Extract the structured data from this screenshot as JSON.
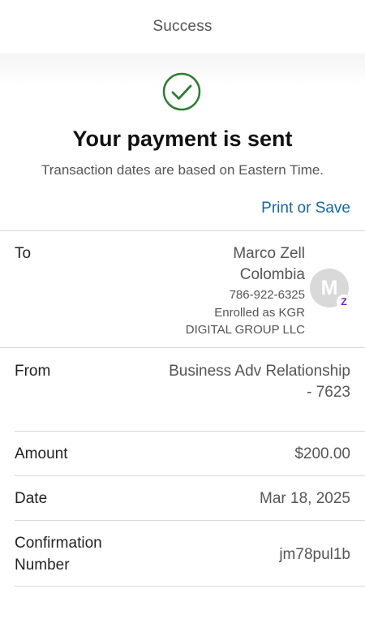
{
  "header": {
    "title": "Success"
  },
  "confirmation": {
    "icon": "check-circle-icon",
    "icon_color": "#2e7d32",
    "headline": "Your payment is sent",
    "note": "Transaction dates are based on Eastern Time."
  },
  "print_label": "Print or Save",
  "link_color": "#1467a8",
  "to": {
    "label": "To",
    "name_line1": "Marco Zell",
    "name_line2": "Colombia",
    "phone": "786-922-6325",
    "enrolled_line1": "Enrolled as KGR",
    "enrolled_line2": "DIGITAL GROUP LLC",
    "avatar_initial": "M",
    "badge_icon": "zelle-icon"
  },
  "from": {
    "label": "From",
    "account_line1": "Business Adv Relationship",
    "account_line2": "- 7623"
  },
  "amount": {
    "label": "Amount",
    "value": "$200.00"
  },
  "date": {
    "label": "Date",
    "value": "Mar 18, 2025"
  },
  "confirmation_number": {
    "label_line1": "Confirmation",
    "label_line2": "Number",
    "value": "jm78pul1b"
  }
}
